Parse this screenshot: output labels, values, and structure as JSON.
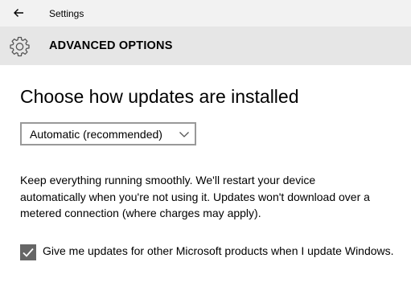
{
  "titlebar": {
    "back_icon": "back-arrow-icon",
    "app_title": "Settings"
  },
  "header": {
    "icon": "gear-icon",
    "title": "ADVANCED OPTIONS"
  },
  "main": {
    "heading": "Choose how updates are installed",
    "install_mode": {
      "selected": "Automatic (recommended)",
      "chevron_icon": "chevron-down-icon"
    },
    "description": "Keep everything running smoothly. We'll restart your device automatically when you're not using it. Updates won't download over a metered connection (where charges may apply).",
    "microsoft_updates": {
      "label": "Give me updates for other Microsoft products when I update Windows.",
      "checked": true
    }
  },
  "colors": {
    "titlebar_bg": "#f2f2f2",
    "header_bg": "#e6e6e6",
    "checkbox_fill": "#666666",
    "dropdown_border": "#999999"
  }
}
